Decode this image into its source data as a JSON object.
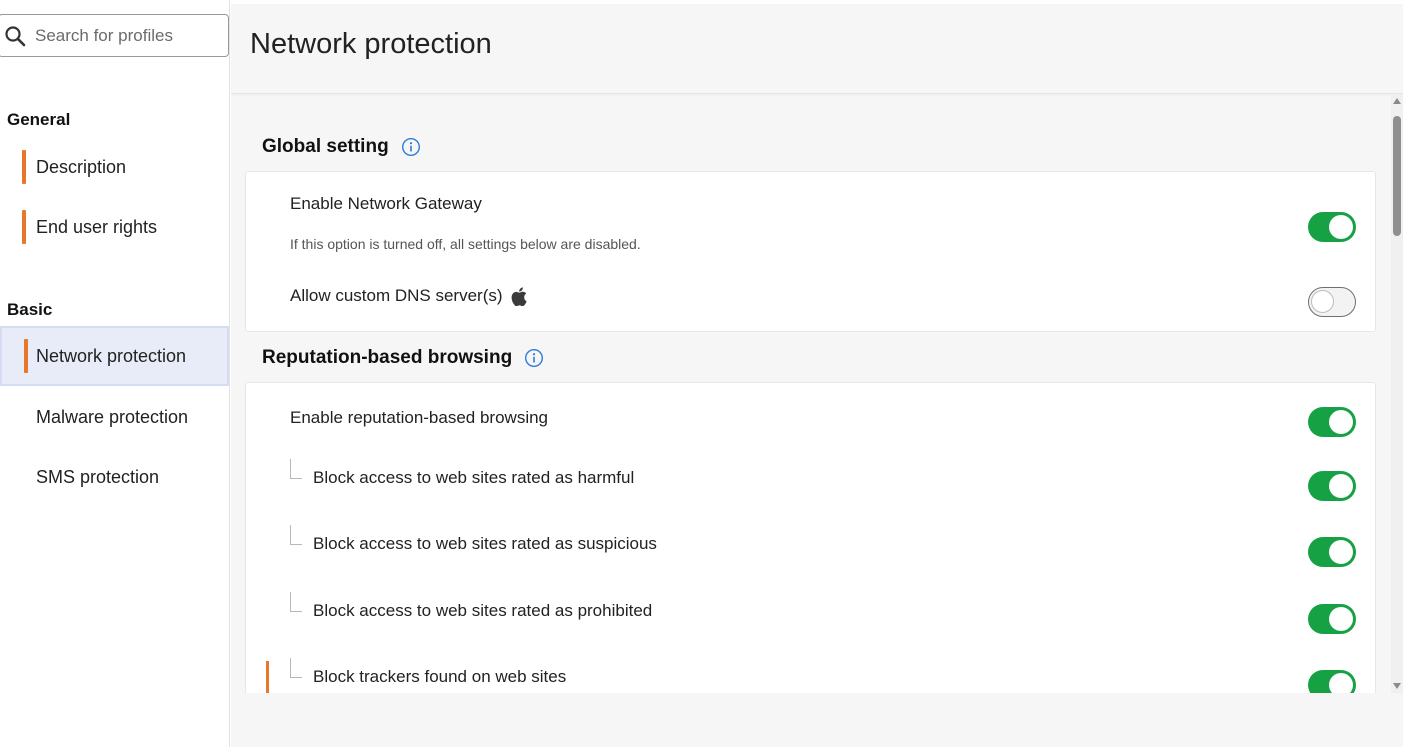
{
  "search": {
    "placeholder": "Search for profiles"
  },
  "sidebar": {
    "sections": [
      {
        "title": "General",
        "items": [
          {
            "label": "Description"
          },
          {
            "label": "End user rights"
          }
        ]
      },
      {
        "title": "Basic",
        "items": [
          {
            "label": "Network protection",
            "active": true
          },
          {
            "label": "Malware protection"
          },
          {
            "label": "SMS protection"
          }
        ]
      }
    ]
  },
  "main": {
    "title": "Network protection",
    "global": {
      "title": "Global setting",
      "gateway_label": "Enable Network Gateway",
      "gateway_sub": "If this option is turned off, all settings below are disabled.",
      "gateway_on": true,
      "dns_label": "Allow custom DNS server(s)",
      "dns_on": false
    },
    "reputation": {
      "title": "Reputation-based browsing",
      "enable_label": "Enable reputation-based browsing",
      "harmful_label": "Block access to web sites rated as harmful",
      "suspicious_label": "Block access to web sites rated as suspicious",
      "prohibited_label": "Block access to web sites rated as prohibited",
      "trackers_label": "Block trackers found on web sites"
    }
  },
  "colors": {
    "toggle_on": "#16a244",
    "accent": "#e8772e",
    "info": "#2f7bd6"
  }
}
